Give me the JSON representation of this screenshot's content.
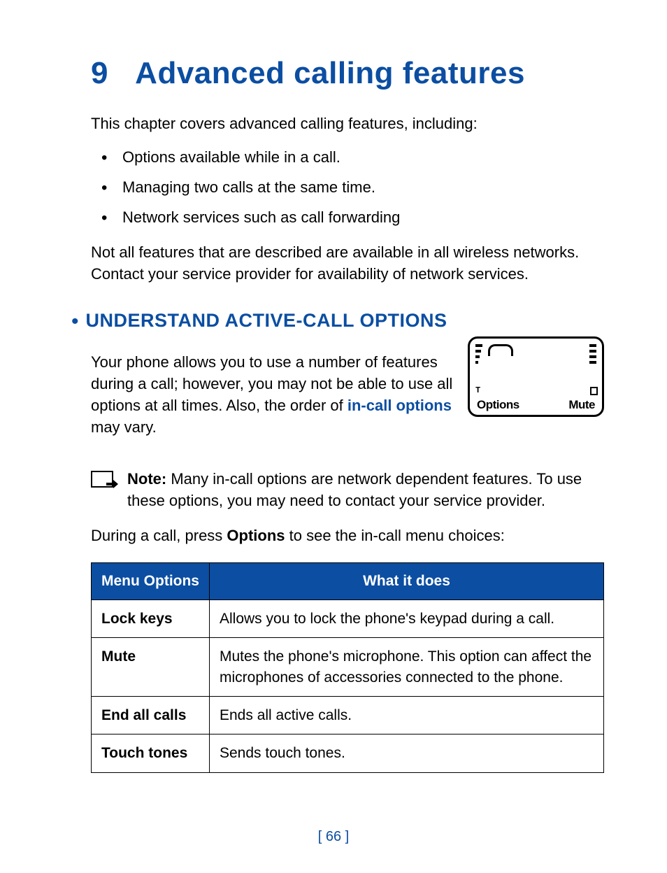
{
  "chapter": {
    "number": "9",
    "title": "Advanced calling features"
  },
  "intro": "This chapter covers advanced calling features, including:",
  "bullets": [
    "Options available while in a call.",
    "Managing two calls at the same time.",
    "Network services such as call forwarding"
  ],
  "intro_note": "Not all features that are described are available in all wireless networks. Contact your service provider for availability of network services.",
  "section": {
    "heading": "UNDERSTAND ACTIVE-CALL OPTIONS",
    "body_pre": "Your phone allows you to use a number of features during a call; however, you may not be able to use all options at all times. Also, the order of ",
    "body_link": "in-call options",
    "body_post": " may vary."
  },
  "phone_screen": {
    "left_label": "Options",
    "right_label": "Mute"
  },
  "note": {
    "label": "Note:",
    "text": "  Many in-call options are network dependent features. To use these options, you may need to contact your service provider."
  },
  "after_note_pre": "During a call, press ",
  "after_note_bold": "Options",
  "after_note_post": " to see the in-call menu choices:",
  "table": {
    "headers": {
      "col1": "Menu Options",
      "col2": "What it does"
    },
    "rows": [
      {
        "option": "Lock keys",
        "desc": "Allows you to lock the phone's keypad during a call."
      },
      {
        "option": "Mute",
        "desc": "Mutes the phone's microphone. This option can affect the microphones of accessories connected to the phone."
      },
      {
        "option": "End all calls",
        "desc": "Ends all active calls."
      },
      {
        "option": "Touch tones",
        "desc": "Sends touch tones."
      }
    ]
  },
  "page_number": "[ 66 ]"
}
